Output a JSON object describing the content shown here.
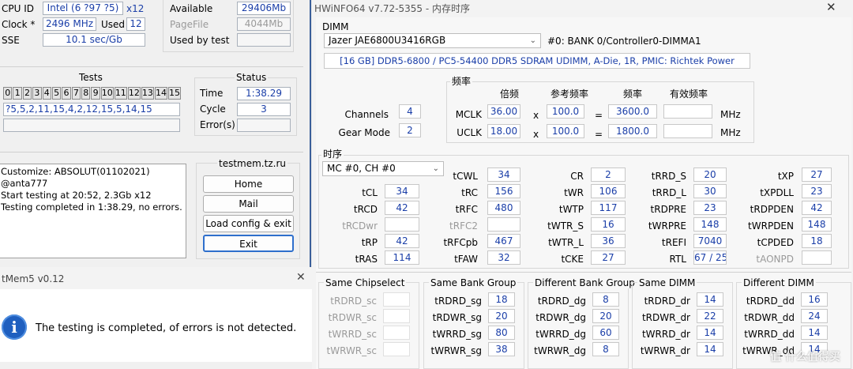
{
  "tm5": {
    "cpu_id_label": "CPU ID",
    "cpu_id_value": "Intel (6 ?97 ?5)",
    "cpu_threads": "x12",
    "clock_label": "Clock *",
    "clock_value": "2496 MHz",
    "used_label": "Used",
    "used_value": "12",
    "sse_label": "SSE",
    "sse_value": "10.1 sec/Gb",
    "available_label": "Available",
    "available_value": "29406Mb",
    "pagefile_label": "PageFile",
    "pagefile_value": "4044Mb",
    "usedbytest_label": "Used by test",
    "tests_title": "Tests",
    "test_numbers": [
      "0",
      "1",
      "2",
      "3",
      "4",
      "5",
      "6",
      "7",
      "8",
      "9",
      "10",
      "11",
      "12",
      "13",
      "14",
      "15"
    ],
    "test_sequence": "?5,5,2,11,15,4,2,12,15,5,14,15",
    "status_title": "Status",
    "time_label": "Time",
    "time_value": "1:38.29",
    "cycle_label": "Cycle",
    "cycle_value": "3",
    "errors_label": "Error(s)",
    "log_lines": [
      "Customize: ABSOLUT(01102021) @anta777",
      "Start testing at 20:52, 2.3Gb x12",
      "Testing completed in 1:38.29, no errors."
    ],
    "site_title": "testmem.tz.ru",
    "home_btn": "Home",
    "mail_btn": "Mail",
    "load_btn": "Load config & exit",
    "exit_btn": "Exit"
  },
  "dialog": {
    "title": "tMem5 v0.12",
    "message": "The testing is completed, of errors is not detected.",
    "close": "✕",
    "icon": "info-icon"
  },
  "hw": {
    "title": "HWiNFO64 v7.72-5355 - 内存时序",
    "close": "✕",
    "dimm_label": "DIMM",
    "dimm_select": "Jazer JAE6800U3416RGB",
    "dimm_slot": "#0: BANK 0/Controller0-DIMMA1",
    "dimm_desc": "[16 GB] DDR5-6800 / PC5-54400 DDR5 SDRAM UDIMM, A-Die, 1R, PMIC: Richtek Power",
    "freq_title": "频率",
    "freq_hdr_freq": "倍频",
    "freq_hdr_ref": "参考频率",
    "freq_hdr_f": "频率",
    "freq_hdr_eff": "有效频率",
    "channels_label": "Channels",
    "channels_value": "4",
    "gear_label": "Gear Mode",
    "gear_value": "2",
    "mclk_label": "MCLK",
    "mclk_mult": "36.00",
    "mclk_ref": "100.0",
    "mclk_freq": "3600.0",
    "uclk_label": "UCLK",
    "uclk_mult": "18.00",
    "uclk_ref": "100.0",
    "uclk_freq": "1800.0",
    "x_sign": "x",
    "eq_sign": "=",
    "mhz": "MHz",
    "timing_title": "时序",
    "mc_select": "MC #0, CH #0",
    "col1": [
      {
        "label": "tCL",
        "value": "34",
        "dim": false
      },
      {
        "label": "tRCD",
        "value": "42",
        "dim": false
      },
      {
        "label": "tRCDwr",
        "value": "",
        "dim": true
      },
      {
        "label": "tRP",
        "value": "42",
        "dim": false
      },
      {
        "label": "tRAS",
        "value": "114",
        "dim": false
      }
    ],
    "col2": [
      {
        "label": "tCWL",
        "value": "34",
        "dim": false
      },
      {
        "label": "tRC",
        "value": "156",
        "dim": false
      },
      {
        "label": "tRFC",
        "value": "480",
        "dim": false
      },
      {
        "label": "tRFC2",
        "value": "",
        "dim": true
      },
      {
        "label": "tRFCpb",
        "value": "467",
        "dim": false
      },
      {
        "label": "tFAW",
        "value": "32",
        "dim": false
      }
    ],
    "col3": [
      {
        "label": "CR",
        "value": "2",
        "dim": false
      },
      {
        "label": "tWR",
        "value": "106",
        "dim": false
      },
      {
        "label": "tWTP",
        "value": "117",
        "dim": false
      },
      {
        "label": "tWTR_S",
        "value": "16",
        "dim": false
      },
      {
        "label": "tWTR_L",
        "value": "36",
        "dim": false
      },
      {
        "label": "tCKE",
        "value": "27",
        "dim": false
      }
    ],
    "col4": [
      {
        "label": "tRRD_S",
        "value": "20",
        "dim": false
      },
      {
        "label": "tRRD_L",
        "value": "30",
        "dim": false
      },
      {
        "label": "tRDPRE",
        "value": "23",
        "dim": false
      },
      {
        "label": "tWRPRE",
        "value": "148",
        "dim": false
      },
      {
        "label": "tREFI",
        "value": "7040",
        "dim": false
      },
      {
        "label": "RTL",
        "value": "67 / 25",
        "dim": false
      }
    ],
    "col5": [
      {
        "label": "tXP",
        "value": "27",
        "dim": false
      },
      {
        "label": "tXPDLL",
        "value": "23",
        "dim": false
      },
      {
        "label": "tRDPDEN",
        "value": "42",
        "dim": false
      },
      {
        "label": "tWRPDEN",
        "value": "148",
        "dim": false
      },
      {
        "label": "tCPDED",
        "value": "18",
        "dim": false
      },
      {
        "label": "tAONPD",
        "value": "",
        "dim": true
      }
    ],
    "groups": [
      {
        "title": "Same Chipselect",
        "rows": [
          {
            "label": "tRDRD_sc",
            "value": "",
            "dim": true
          },
          {
            "label": "tRDWR_sc",
            "value": "",
            "dim": true
          },
          {
            "label": "tWRRD_sc",
            "value": "",
            "dim": true
          },
          {
            "label": "tWRWR_sc",
            "value": "",
            "dim": true
          }
        ]
      },
      {
        "title": "Same Bank Group",
        "rows": [
          {
            "label": "tRDRD_sg",
            "value": "18",
            "dim": false
          },
          {
            "label": "tRDWR_sg",
            "value": "20",
            "dim": false
          },
          {
            "label": "tWRRD_sg",
            "value": "80",
            "dim": false
          },
          {
            "label": "tWRWR_sg",
            "value": "38",
            "dim": false
          }
        ]
      },
      {
        "title": "Different Bank Group",
        "rows": [
          {
            "label": "tRDRD_dg",
            "value": "8",
            "dim": false
          },
          {
            "label": "tRDWR_dg",
            "value": "20",
            "dim": false
          },
          {
            "label": "tWRRD_dg",
            "value": "60",
            "dim": false
          },
          {
            "label": "tWRWR_dg",
            "value": "8",
            "dim": false
          }
        ]
      },
      {
        "title": "Same DIMM",
        "rows": [
          {
            "label": "tRDRD_dr",
            "value": "14",
            "dim": false
          },
          {
            "label": "tRDWR_dr",
            "value": "22",
            "dim": false
          },
          {
            "label": "tWRRD_dr",
            "value": "14",
            "dim": false
          },
          {
            "label": "tWRWR_dr",
            "value": "14",
            "dim": false
          }
        ]
      },
      {
        "title": "Different DIMM",
        "rows": [
          {
            "label": "tRDRD_dd",
            "value": "16",
            "dim": false
          },
          {
            "label": "tRDWR_dd",
            "value": "24",
            "dim": false
          },
          {
            "label": "tWRRD_dd",
            "value": "14",
            "dim": false
          },
          {
            "label": "tWRWR_dd",
            "value": "14",
            "dim": false
          }
        ]
      }
    ],
    "watermark": "值 什么值得买"
  }
}
